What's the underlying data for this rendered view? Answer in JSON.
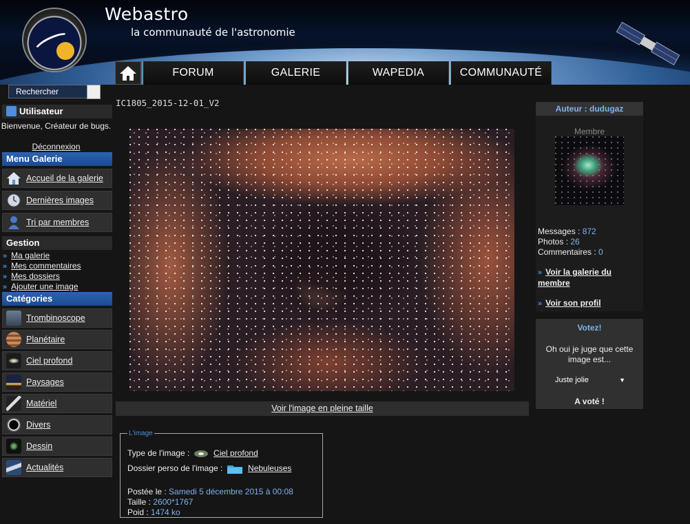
{
  "site": {
    "title": "Webastro",
    "subtitle": "la communauté de l'astronomie"
  },
  "nav": {
    "home_icon": "home-icon",
    "items": [
      "FORUM",
      "GALERIE",
      "WAPEDIA",
      "COMMUNAUTÉ"
    ]
  },
  "search": {
    "label": "Recherche​r"
  },
  "user": {
    "heading": "Utilisateur",
    "welcome": "Bienvenue, Créateur de bugs.",
    "logout": "Déconnexion"
  },
  "gallery_menu": {
    "heading": "Menu Galerie",
    "items": [
      "Accueil de la galerie",
      "Dernières images",
      "Tri par membres"
    ]
  },
  "gestion": {
    "heading": "Gestion",
    "links": [
      "Ma galerie",
      "Mes commentaires",
      "Mes dossiers",
      "Ajouter une image"
    ]
  },
  "categories": {
    "heading": "Catégories",
    "items": [
      "Trombinoscope",
      "Planétaire",
      "Ciel profond",
      "Paysages",
      "Matériel",
      "Divers",
      "Dessin",
      "Actualités"
    ]
  },
  "image": {
    "title": "IC1805_2015-12-01_V2",
    "full_size_link": "Voir l'image en pleine taille"
  },
  "info": {
    "legend": "L'image",
    "type_label": "Type de l'image :",
    "type_value": "Ciel profond",
    "folder_label": "Dossier perso de l'image :",
    "folder_value": "Nebuleuses",
    "posted_label": "Postée le :",
    "posted_value": "Samedi 5 décembre 2015 à 00:08",
    "size_label": "Taille :",
    "size_value": "2600*1767",
    "weight_label": "Poid :",
    "weight_value": "1474 ko"
  },
  "author": {
    "heading": "Auteur : dudugaz",
    "role": "Membre",
    "messages_label": "Messages :",
    "messages_value": "872",
    "photos_label": "Photos :",
    "photos_value": "26",
    "comments_label": "Commentaires :",
    "comments_value": "0",
    "gallery_link": "Voir la galerie du membre",
    "profile_link": "Voir son profil"
  },
  "vote": {
    "heading": "Votez!",
    "question": "Oh oui je juge que cette image est...",
    "selected": "Juste jolie",
    "voted": "A voté !"
  }
}
